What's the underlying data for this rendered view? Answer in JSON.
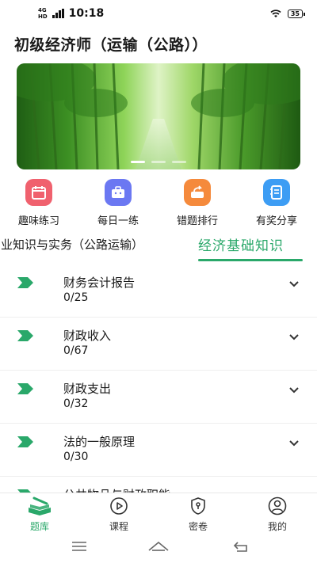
{
  "status_bar": {
    "time": "10:18",
    "network": "4G",
    "network_sub": "HD",
    "battery": "35"
  },
  "header": {
    "title": "初级经济师（运输（公路））"
  },
  "banner": {
    "slide_count": 3,
    "active_slide": 1,
    "image": "bamboo-forest-photo"
  },
  "quick_actions": [
    {
      "label": "趣味练习",
      "icon": "calendar-icon",
      "color": "#f0616e"
    },
    {
      "label": "每日一练",
      "icon": "briefcase-icon",
      "color": "#6b78f2"
    },
    {
      "label": "错题排行",
      "icon": "share-box-icon",
      "color": "#f58a3c"
    },
    {
      "label": "有奖分享",
      "icon": "notebook-icon",
      "color": "#3d9df4"
    }
  ],
  "subject_tabs": [
    {
      "label": "专业知识与实务（公路运输）",
      "active": false
    },
    {
      "label": "经济基础知识",
      "active": true
    }
  ],
  "chapters": [
    {
      "title": "财务会计报告",
      "progress": "0/25"
    },
    {
      "title": "财政收入",
      "progress": "0/67"
    },
    {
      "title": "财政支出",
      "progress": "0/32"
    },
    {
      "title": "法的一般原理",
      "progress": "0/30"
    },
    {
      "title": "公共物品与财政职能",
      "progress": ""
    }
  ],
  "tabbar": [
    {
      "label": "题库",
      "icon": "book-stack-icon",
      "active": true
    },
    {
      "label": "课程",
      "icon": "play-circle-icon",
      "active": false
    },
    {
      "label": "密卷",
      "icon": "shield-lock-icon",
      "active": false
    },
    {
      "label": "我的",
      "icon": "user-circle-icon",
      "active": false
    }
  ],
  "colors": {
    "accent": "#2aa86a",
    "text": "#1a1a1a"
  }
}
